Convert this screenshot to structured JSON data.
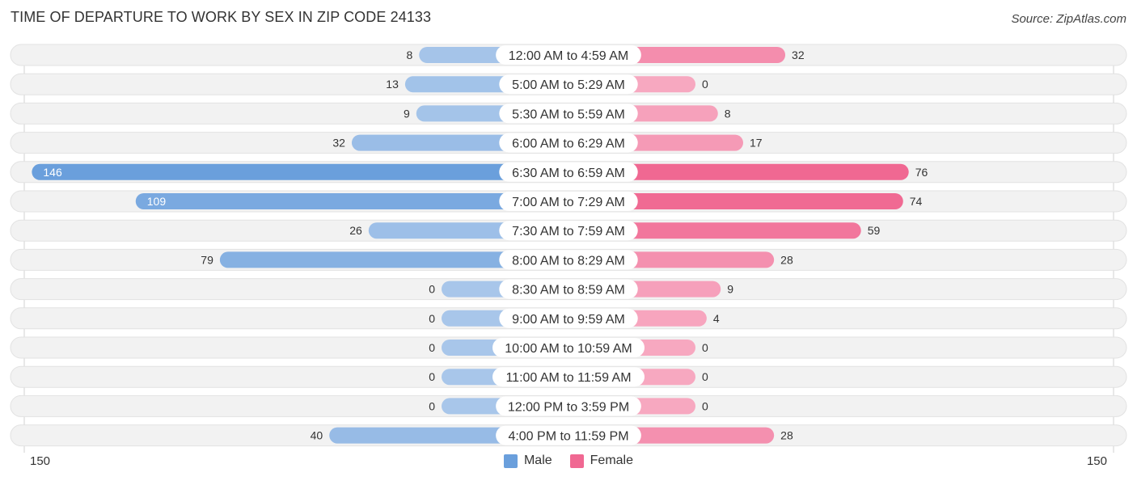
{
  "header": {
    "title": "TIME OF DEPARTURE TO WORK BY SEX IN ZIP CODE 24133",
    "source": "Source: ZipAtlas.com"
  },
  "colors": {
    "male": "#6a9fdc",
    "male_light": "#a8c6ea",
    "female": "#f06892",
    "female_light": "#f7a8c0",
    "row_bg": "#f2f2f2"
  },
  "chart_data": {
    "type": "bar",
    "orientation": "horizontal-diverging",
    "title": "TIME OF DEPARTURE TO WORK BY SEX IN ZIP CODE 24133",
    "categories": [
      "12:00 AM to 4:59 AM",
      "5:00 AM to 5:29 AM",
      "5:30 AM to 5:59 AM",
      "6:00 AM to 6:29 AM",
      "6:30 AM to 6:59 AM",
      "7:00 AM to 7:29 AM",
      "7:30 AM to 7:59 AM",
      "8:00 AM to 8:29 AM",
      "8:30 AM to 8:59 AM",
      "9:00 AM to 9:59 AM",
      "10:00 AM to 10:59 AM",
      "11:00 AM to 11:59 AM",
      "12:00 PM to 3:59 PM",
      "4:00 PM to 11:59 PM"
    ],
    "series": [
      {
        "name": "Male",
        "side": "left",
        "values": [
          8,
          13,
          9,
          32,
          146,
          109,
          26,
          79,
          0,
          0,
          0,
          0,
          0,
          40
        ]
      },
      {
        "name": "Female",
        "side": "right",
        "values": [
          32,
          0,
          8,
          17,
          76,
          74,
          59,
          28,
          9,
          4,
          0,
          0,
          0,
          28
        ]
      }
    ],
    "axis": {
      "left_label": "150",
      "right_label": "150",
      "max": 150
    },
    "legend": {
      "position": "bottom-center",
      "entries": [
        "Male",
        "Female"
      ]
    },
    "grid": false
  }
}
